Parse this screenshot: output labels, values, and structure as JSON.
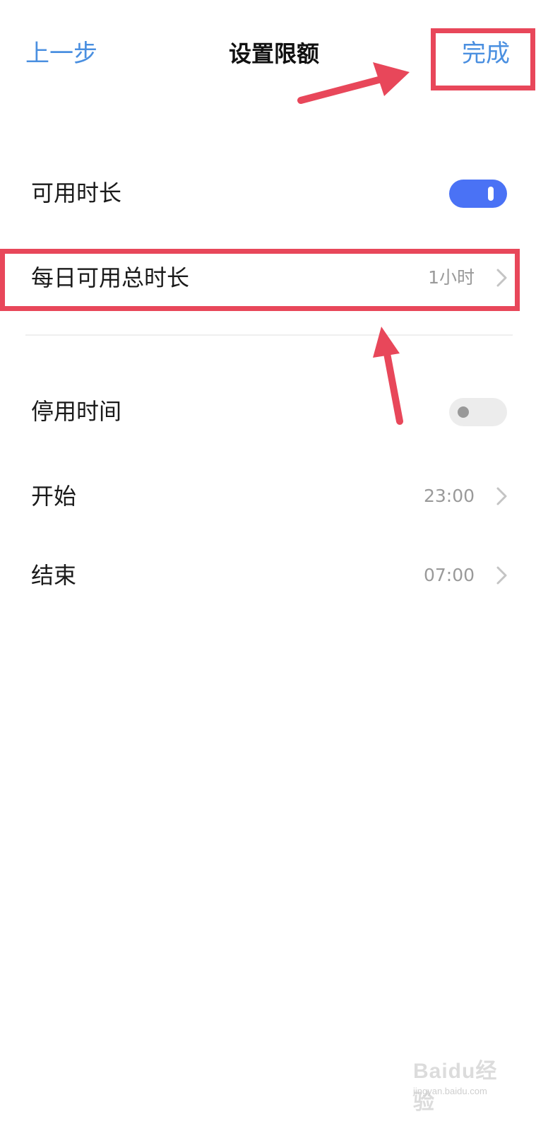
{
  "header": {
    "back_label": "上一步",
    "title": "设置限额",
    "done_label": "完成"
  },
  "rows": {
    "available_duration": {
      "label": "可用时长",
      "toggle_on": true
    },
    "daily_total": {
      "label": "每日可用总时长",
      "value": "1小时"
    },
    "downtime": {
      "label": "停用时间",
      "toggle_on": false
    },
    "start": {
      "label": "开始",
      "value": "23:00"
    },
    "end": {
      "label": "结束",
      "value": "07:00"
    }
  },
  "colors": {
    "accent_blue": "#4a8fe0",
    "toggle_on": "#4a72f5",
    "annotation_red": "#e8475a"
  },
  "watermark": {
    "main": "Baidu经验",
    "sub": "jingyan.baidu.com"
  }
}
